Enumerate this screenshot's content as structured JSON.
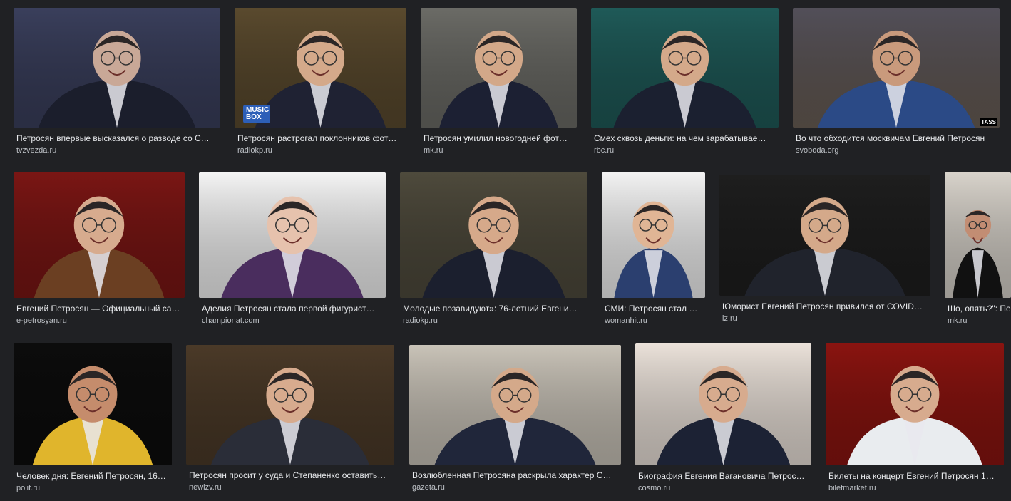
{
  "results": [
    {
      "title": "Петросян впервые высказался о разводе со С…",
      "source": "tvzvezda.ru",
      "bg": "#3a3f5c",
      "fg": "#c9a897",
      "suit": "#1b1e2c",
      "label": ""
    },
    {
      "title": "Петросян растрогал поклонников фот…",
      "source": "radiokp.ru",
      "bg": "#5a4a2e",
      "fg": "#d4a98a",
      "suit": "#1f2233",
      "label": "MUSIC BOX"
    },
    {
      "title": "Петросян умилил новогодней фот…",
      "source": "mk.ru",
      "bg": "#6b6b66",
      "fg": "#d3a889",
      "suit": "#1c2033",
      "label": ""
    },
    {
      "title": "Смех сквозь деньги: на чем зарабатывае…",
      "source": "rbc.ru",
      "bg": "#1f5a58",
      "fg": "#d4a98a",
      "suit": "#1b2030",
      "label": ""
    },
    {
      "title": "Во что обходится москвичам Евгений Петросян",
      "source": "svoboda.org",
      "bg": "#6a5f56",
      "fg": "#c99a7c",
      "suit": "#2b4a86",
      "label": "TASS"
    },
    {
      "title": "Евгений Петросян — Официальный са…",
      "source": "e-petrosyan.ru",
      "bg": "#7a1614",
      "fg": "#d7ab8e",
      "suit": "#6b3f22",
      "label": ""
    },
    {
      "title": "Аделия Петросян стала первой фигурист…",
      "source": "championat.com",
      "bg": "#f4f4f4",
      "fg": "#e6c2ad",
      "suit": "#4a2d5e",
      "label": ""
    },
    {
      "title": "Молодые позавидуют»: 76-летний Евгени…",
      "source": "radiokp.ru",
      "bg": "#4e4a3c",
      "fg": "#d6a98a",
      "suit": "#1b1f2e",
      "label": ""
    },
    {
      "title": "СМИ: Петросян стал …",
      "source": "womanhit.ru",
      "bg": "#f3f3f3",
      "fg": "#e0b595",
      "suit": "#2b3f6f",
      "label": ""
    },
    {
      "title": "Юморист Евгений Петросян привился от COVID…",
      "source": "iz.ru",
      "bg": "#1e1e1e",
      "fg": "#d4a98a",
      "suit": "#20232c",
      "label": ""
    },
    {
      "title": "Шо, опять?\": Пе",
      "source": "mk.ru",
      "bg": "#d8d3cb",
      "fg": "#c28d73",
      "suit": "#111111",
      "label": ""
    },
    {
      "title": "Человек дня: Евгений Петросян, 16…",
      "source": "polit.ru",
      "bg": "#0c0c0c",
      "fg": "#c58c6c",
      "suit": "#e0b52c",
      "label": ""
    },
    {
      "title": "Петросян просит у суда и Степаненко оставить…",
      "source": "newizv.ru",
      "bg": "#4b3a28",
      "fg": "#d7ab8e",
      "suit": "#2a2d38",
      "label": ""
    },
    {
      "title": "Возлюбленная Петросяна раскрыла характер С…",
      "source": "gazeta.ru",
      "bg": "#c9c3b8",
      "fg": "#d4a98a",
      "suit": "#20263a",
      "label": ""
    },
    {
      "title": "Биография Евгения Вагановича Петрос…",
      "source": "cosmo.ru",
      "bg": "#ebe2da",
      "fg": "#d7ab8e",
      "suit": "#1c2234",
      "label": ""
    },
    {
      "title": "Билеты на концерт Евгений Петросян 1…",
      "source": "biletmarket.ru",
      "bg": "#8a1410",
      "fg": "#d7ab8e",
      "suit": "#e9ecef",
      "label": ""
    }
  ]
}
